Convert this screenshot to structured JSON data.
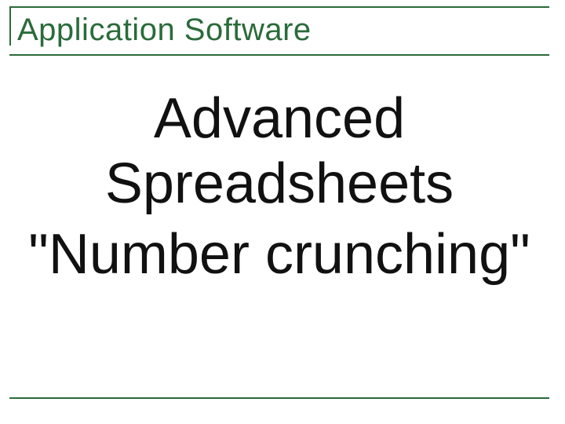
{
  "slide": {
    "heading": "Application Software",
    "content": {
      "line1": "Advanced",
      "line2": "Spreadsheets",
      "line3": "\"Number crunching\""
    }
  },
  "colors": {
    "accent": "#2a6b3a",
    "text": "#111111",
    "background": "#ffffff"
  }
}
